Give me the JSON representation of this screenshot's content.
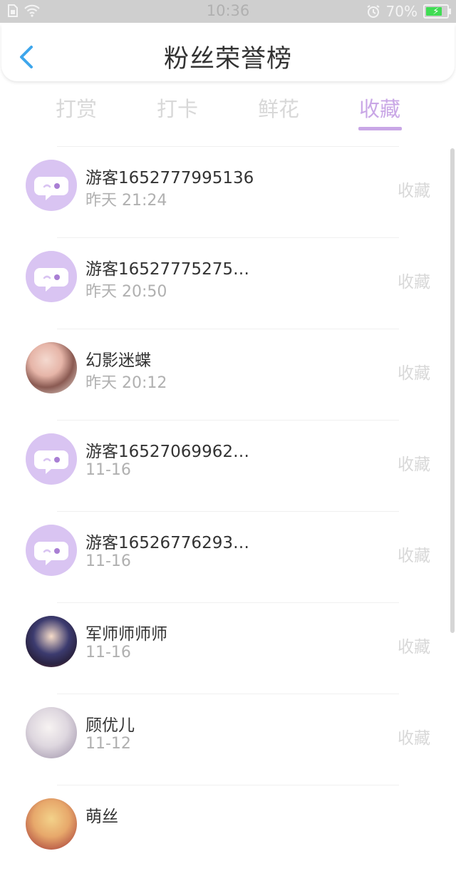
{
  "status_bar": {
    "time": "10:36",
    "battery": "70%"
  },
  "header": {
    "title": "粉丝荣誉榜"
  },
  "tabs": [
    {
      "label": "打赏"
    },
    {
      "label": "打卡"
    },
    {
      "label": "鲜花"
    },
    {
      "label": "收藏"
    }
  ],
  "active_tab": "收藏",
  "colors": {
    "accent": "#c9a7e6",
    "guest_avatar": "#d9c4f2",
    "status_bar": "#cfcfcf",
    "muted_text": "#b0b0b0"
  },
  "fans": [
    {
      "name": "游客1652777995136",
      "time": "昨天  21:24",
      "action": "收藏",
      "avatar": "guest-avatar"
    },
    {
      "name": "游客165277752751…",
      "time": "昨天  20:50",
      "action": "收藏",
      "avatar": "guest-avatar"
    },
    {
      "name": "幻影迷蝶",
      "time": "昨天  20:12",
      "action": "收藏",
      "avatar": "user-photo"
    },
    {
      "name": "游客165270699629…",
      "time": "11-16",
      "action": "收藏",
      "avatar": "guest-avatar"
    },
    {
      "name": "游客165267762935…",
      "time": "11-16",
      "action": "收藏",
      "avatar": "guest-avatar"
    },
    {
      "name": "军师师师师",
      "time": "11-16",
      "action": "收藏",
      "avatar": "user-photo"
    },
    {
      "name": "顾优儿",
      "time": "11-12",
      "action": "收藏",
      "avatar": "user-photo"
    },
    {
      "name": "萌丝",
      "time": "",
      "action": "",
      "avatar": "user-photo"
    }
  ]
}
